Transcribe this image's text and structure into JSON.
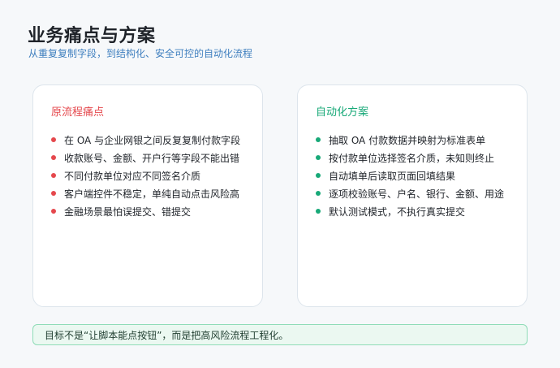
{
  "header": {
    "title": "业务痛点与方案",
    "subtitle": "从重复复制字段，到结构化、安全可控的自动化流程"
  },
  "pain_points": {
    "title": "原流程痛点",
    "items": [
      "在 OA 与企业网银之间反复复制付款字段",
      "收款账号、金额、开户行等字段不能出错",
      "不同付款单位对应不同签名介质",
      "客户端控件不稳定，单纯自动点击风险高",
      "金融场景最怕误提交、错提交"
    ]
  },
  "solution": {
    "title": "自动化方案",
    "items": [
      "抽取 OA 付款数据并映射为标准表单",
      "按付款单位选择签名介质，未知则终止",
      "自动填单后读取页面回填结果",
      "逐项校验账号、户名、银行、金额、用途",
      "默认测试模式，不执行真实提交"
    ]
  },
  "footer": {
    "text": "目标不是“让脚本能点按钮”，而是把高风险流程工程化。"
  },
  "colors": {
    "pain_accent": "#e5484d",
    "solution_accent": "#18a978",
    "subtitle": "#3f7fbf"
  }
}
